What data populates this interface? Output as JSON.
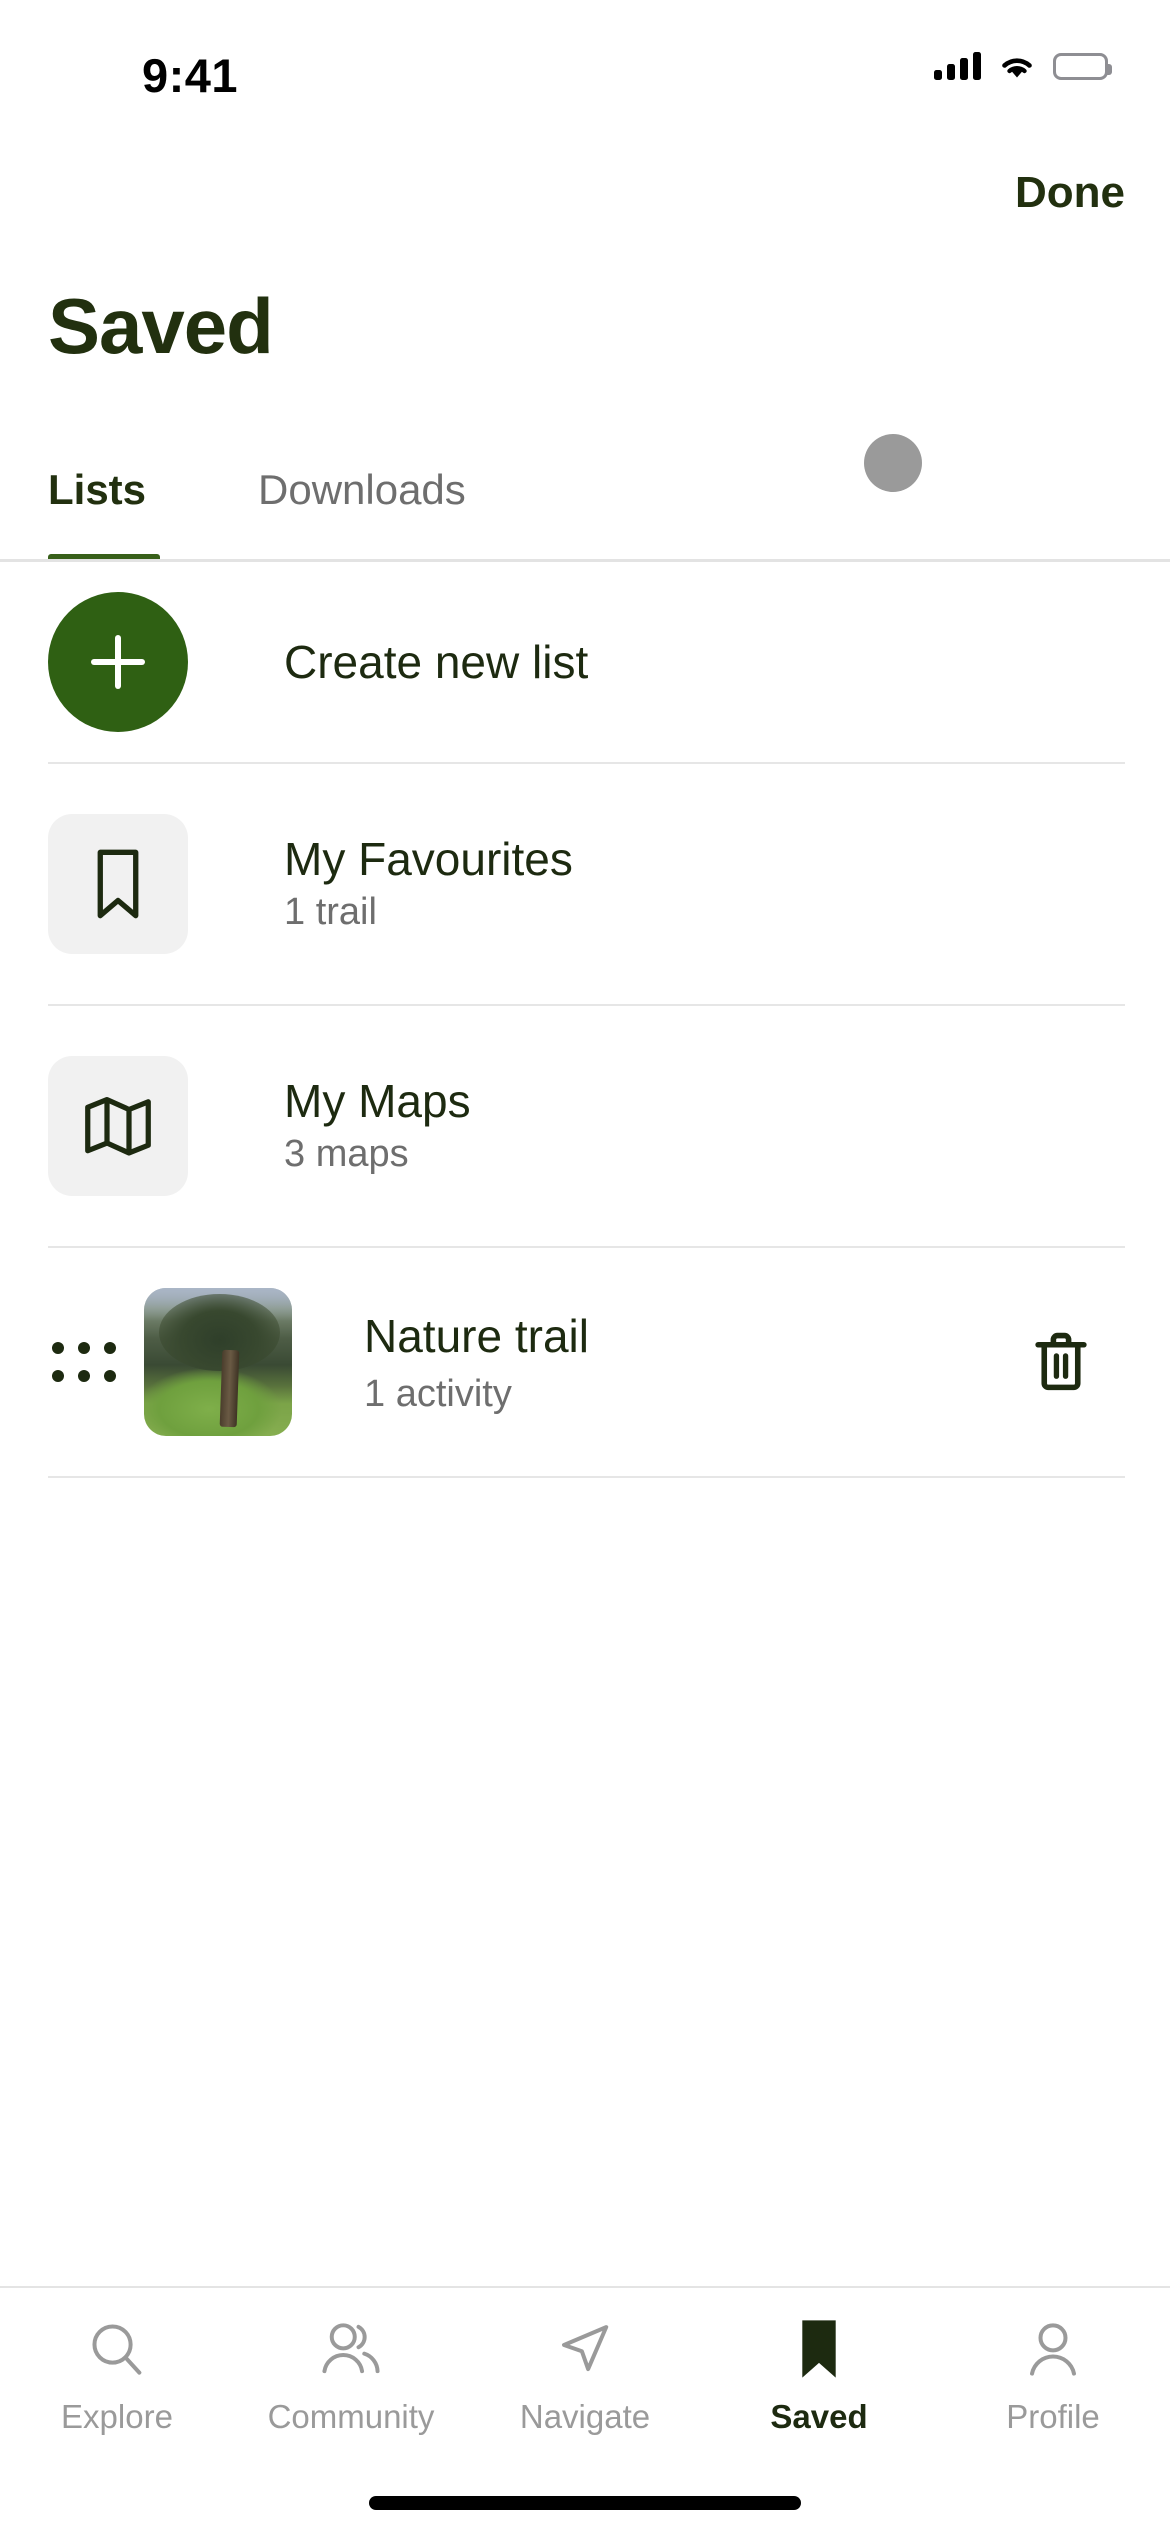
{
  "status_bar": {
    "time": "9:41",
    "signal_icon": "cellular-signal-icon",
    "wifi_icon": "wifi-icon",
    "battery_icon": "battery-full-icon"
  },
  "nav": {
    "done_label": "Done"
  },
  "header": {
    "title": "Saved"
  },
  "tabs": {
    "items": [
      {
        "label": "Lists",
        "active": true
      },
      {
        "label": "Downloads",
        "active": false
      }
    ],
    "avatar_icon": "avatar-placeholder-icon",
    "active_indicator_color": "#38601a"
  },
  "list": {
    "create_row": {
      "label": "Create new list",
      "icon": "plus-icon",
      "circle_color": "#2f6013"
    },
    "items": [
      {
        "title": "My Favourites",
        "subtitle": "1 trail",
        "icon": "bookmark-icon"
      },
      {
        "title": "My Maps",
        "subtitle": "3 maps",
        "icon": "map-icon"
      }
    ],
    "trail_row": {
      "title": "Nature trail",
      "subtitle": "1 activity",
      "drag_icon": "drag-handle-icon",
      "thumbnail": "nature-trail-thumbnail",
      "delete_icon": "trash-icon"
    }
  },
  "bottom_nav": {
    "items": [
      {
        "label": "Explore",
        "icon": "search-icon",
        "active": false
      },
      {
        "label": "Community",
        "icon": "people-icon",
        "active": false
      },
      {
        "label": "Navigate",
        "icon": "navigate-icon",
        "active": false
      },
      {
        "label": "Saved",
        "icon": "bookmark-filled-icon",
        "active": true
      },
      {
        "label": "Profile",
        "icon": "person-icon",
        "active": false
      }
    ],
    "active_color": "#1d2a10",
    "inactive_color": "#9a9a9a"
  },
  "theme": {
    "brand_green": "#2f6013",
    "text_dark": "#1d2a10",
    "text_muted": "#6e6e6e"
  }
}
